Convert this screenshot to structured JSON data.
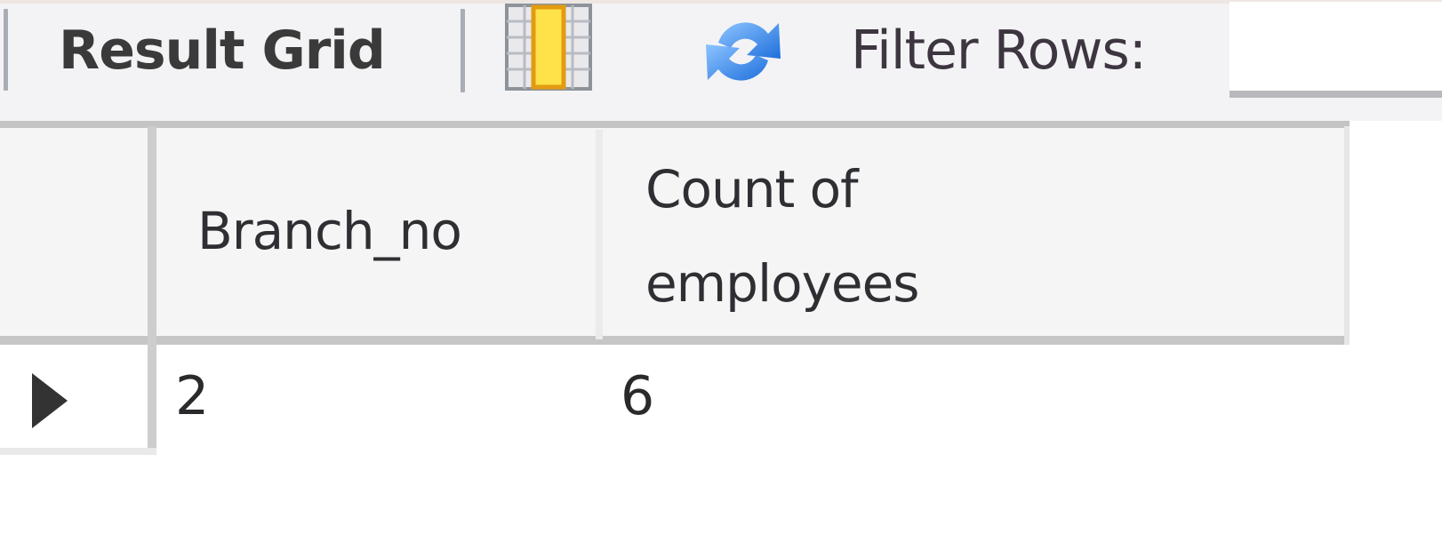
{
  "toolbar": {
    "result_grid_label": "Result Grid",
    "filter_label": "Filter Rows:",
    "filter_value": "",
    "icons": {
      "grid_toggle": "grid-yellow-column-icon",
      "refresh": "refresh-arrows-icon"
    }
  },
  "grid": {
    "columns": [
      "Branch_no",
      "Count of employees"
    ],
    "rows": [
      [
        "2",
        "6"
      ]
    ]
  },
  "colors": {
    "toolbar_bg": "#f3f3f5",
    "accent_yellow": "#ffe24a",
    "refresh_blue": "#2f7fe6"
  }
}
